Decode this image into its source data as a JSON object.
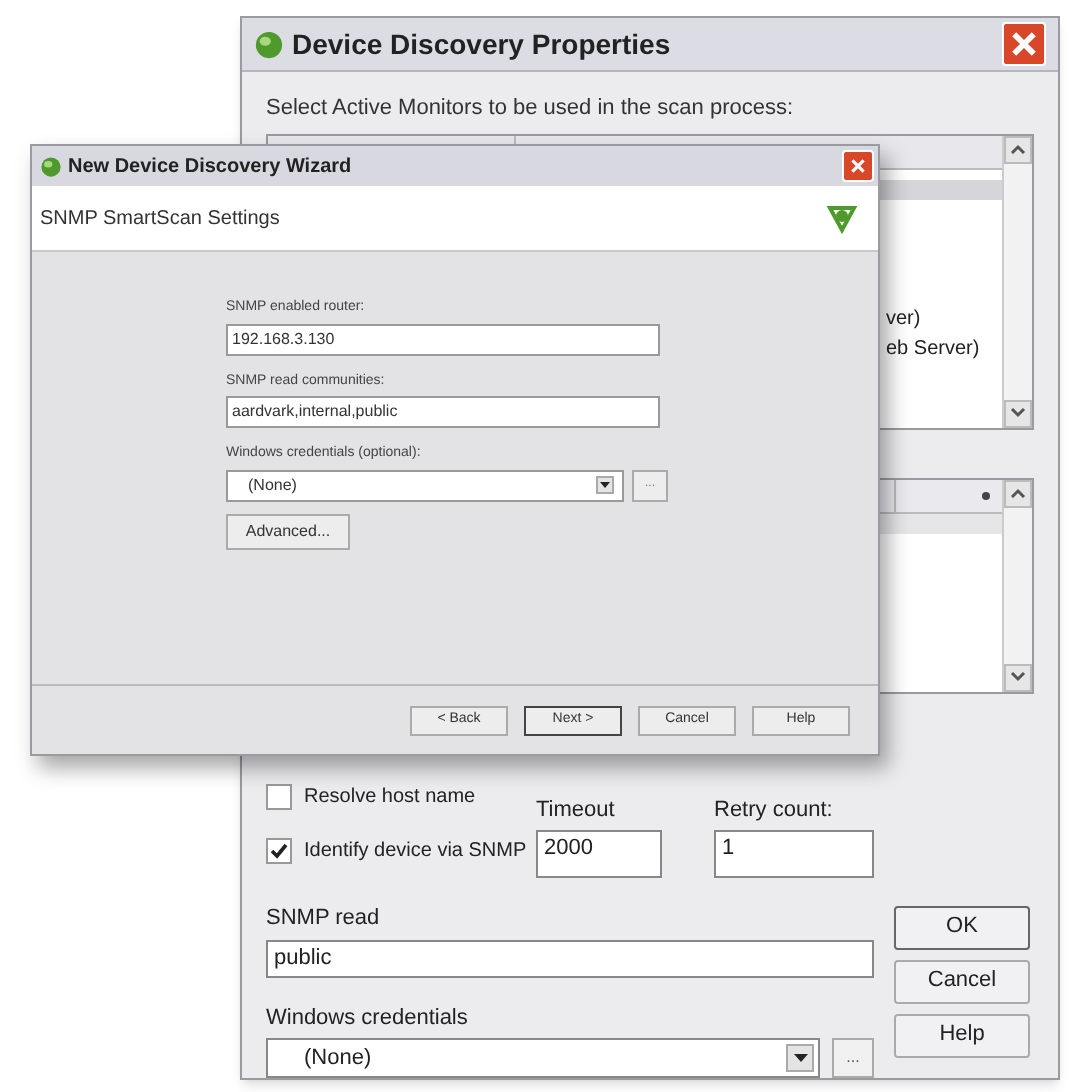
{
  "back_window": {
    "title": "Device Discovery Properties",
    "prompt": "Select Active Monitors to be used in the scan process:",
    "monitors": [
      {
        "label": "ver)"
      },
      {
        "label": "eb Server)"
      }
    ],
    "options": [
      {
        "label": "Resolve host name",
        "checked": false
      },
      {
        "label": "Identify device via SNMP",
        "checked": true
      }
    ],
    "timeout": {
      "label": "Timeout",
      "value": "2000"
    },
    "retry": {
      "label": "Retry count:",
      "value": "1"
    },
    "snmp_read": {
      "label": "SNMP read",
      "value": "public"
    },
    "credentials": {
      "label": "Windows credentials",
      "value": "(None)",
      "browse": "..."
    },
    "buttons": [
      "OK",
      "Cancel",
      "Help"
    ]
  },
  "wizard": {
    "title": "New Device Discovery Wizard",
    "heading": "SNMP SmartScan Settings",
    "router": {
      "label": "SNMP enabled router:",
      "value": "192.168.3.130"
    },
    "communities": {
      "label": "SNMP read communities:",
      "value": "aardvark,internal,public"
    },
    "credentials": {
      "label": "Windows credentials (optional):",
      "value": "(None)",
      "browse": "..."
    },
    "advanced": "Advanced...",
    "buttons": [
      {
        "label": "< Back",
        "default": false
      },
      {
        "label": "Next >",
        "default": true
      },
      {
        "label": "Cancel",
        "default": false
      },
      {
        "label": "Help",
        "default": false
      }
    ]
  }
}
